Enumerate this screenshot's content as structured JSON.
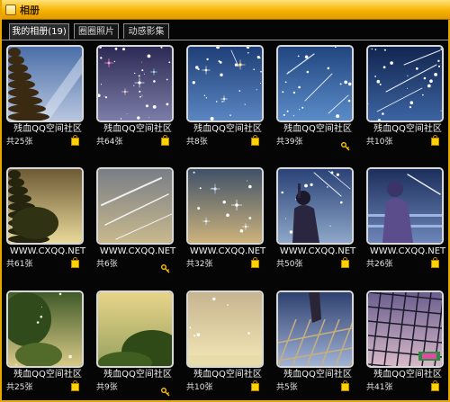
{
  "window": {
    "title": "相册"
  },
  "tabs": [
    {
      "label": "我的相册(19)",
      "active": true
    },
    {
      "label": "圈圈照片",
      "active": false
    },
    {
      "label": "动感影集",
      "active": false
    }
  ],
  "albums": [
    {
      "caption": "残血QQ空间社区",
      "count": "共25张",
      "badge": "lock",
      "scene": "tree-sky"
    },
    {
      "caption": "残血QQ空间社区",
      "count": "共64张",
      "badge": "lock",
      "scene": "stars-purple"
    },
    {
      "caption": "残血QQ空间社区",
      "count": "共8张",
      "badge": "lock",
      "scene": "stars-blue"
    },
    {
      "caption": "残血QQ空间社区",
      "count": "共39张",
      "badge": "key",
      "scene": "meteor-blue"
    },
    {
      "caption": "残血QQ空间社区",
      "count": "共10张",
      "badge": "lock",
      "scene": "meteor-dark"
    },
    {
      "caption": "WWW.CXQQ.NET",
      "count": "共61张",
      "badge": "lock",
      "scene": "tree-dusk"
    },
    {
      "caption": "WWW.CXQQ.NET",
      "count": "共6张",
      "badge": "key",
      "scene": "meteor-gold"
    },
    {
      "caption": "WWW.CXQQ.NET",
      "count": "共32张",
      "badge": "lock",
      "scene": "stars-gold"
    },
    {
      "caption": "WWW.CXQQ.NET",
      "count": "共50张",
      "badge": "lock",
      "scene": "person-blue"
    },
    {
      "caption": "WWW.CXQQ.NET",
      "count": "共26张",
      "badge": "lock",
      "scene": "person-rail"
    },
    {
      "caption": "残血QQ空间社区",
      "count": "共25张",
      "badge": "lock",
      "scene": "tree-green"
    },
    {
      "caption": "残血QQ空间社区",
      "count": "共9张",
      "badge": "key",
      "scene": "tree-sun"
    },
    {
      "caption": "残血QQ空间社区",
      "count": "共10张",
      "badge": "lock",
      "scene": "sky-gold"
    },
    {
      "caption": "残血QQ空间社区",
      "count": "共5张",
      "badge": "lock",
      "scene": "grid-person"
    },
    {
      "caption": "残血QQ空间社区",
      "count": "共41张",
      "badge": "lock",
      "scene": "grid-pink"
    }
  ]
}
